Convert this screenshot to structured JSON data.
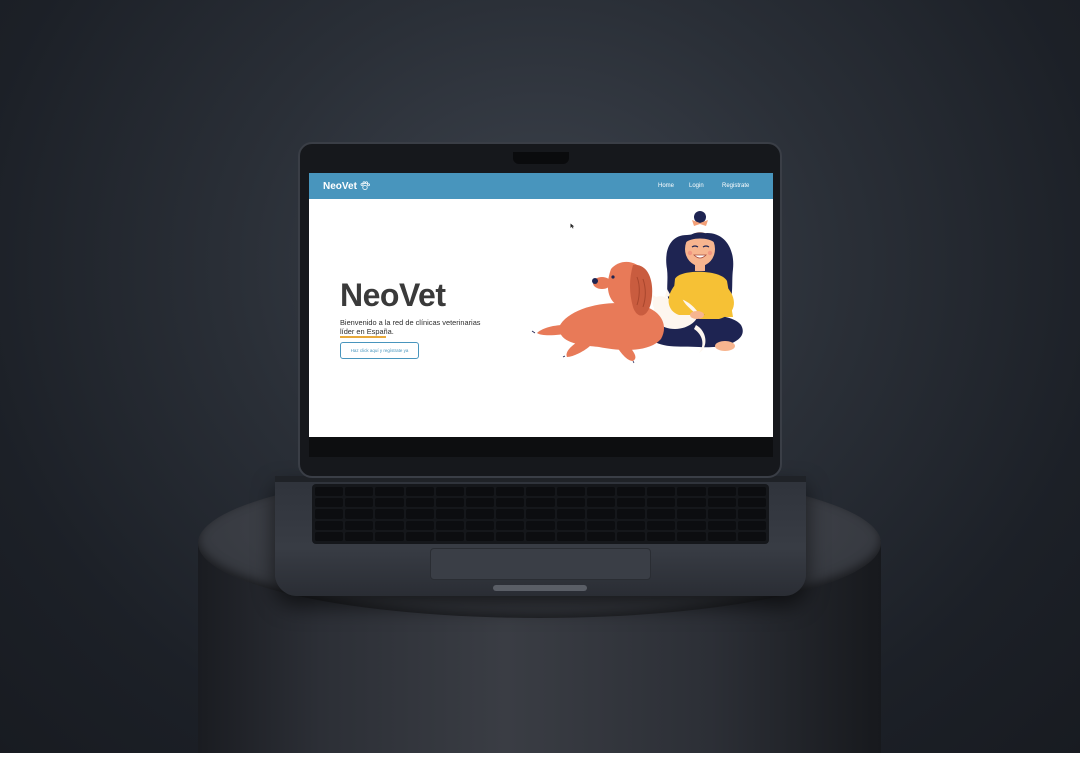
{
  "site": {
    "brand": "NeoVet",
    "nav": {
      "home": "Home",
      "login": "Login",
      "register": "Registrate"
    },
    "hero": {
      "title": "NeoVet",
      "subtitle": "Bienvenido a la red de clínicas veterinarias líder en España.",
      "cta_label": "Haz click aquí y regístrate ya"
    }
  },
  "colors": {
    "nav_bg": "#4895bd",
    "accent_underline": "#e8a93a",
    "title": "#3a3a3a"
  },
  "icons": [
    "paw-icon",
    "cursor-icon"
  ]
}
